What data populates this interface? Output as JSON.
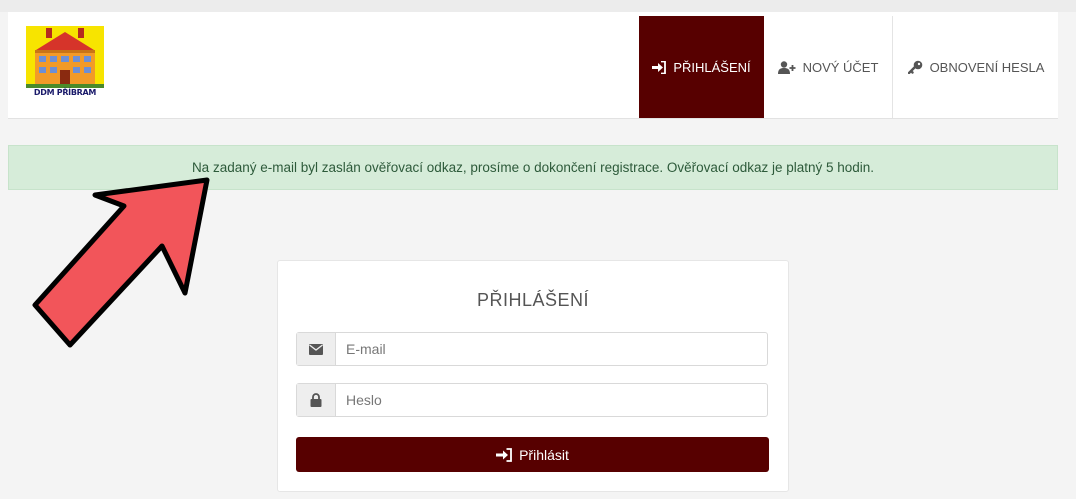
{
  "logo": {
    "text": "DDM PŘÍBRAM"
  },
  "nav": {
    "items": [
      {
        "label": "PŘIHLÁŠENÍ",
        "icon": "sign-in-icon",
        "active": true
      },
      {
        "label": "NOVÝ ÚČET",
        "icon": "user-plus-icon",
        "active": false
      },
      {
        "label": "OBNOVENÍ HESLA",
        "icon": "key-icon",
        "active": false
      }
    ]
  },
  "alert": {
    "message": "Na zadaný e-mail byl zaslán ověřovací odkaz, prosíme o dokončení registrace. Ověřovací odkaz je platný 5 hodin."
  },
  "login": {
    "title": "PŘIHLÁŠENÍ",
    "email_placeholder": "E-mail",
    "password_placeholder": "Heslo",
    "submit_label": "Přihlásit"
  },
  "colors": {
    "brand": "#570000",
    "alert_bg": "#d6ecd9",
    "arrow": "#f2555a"
  }
}
